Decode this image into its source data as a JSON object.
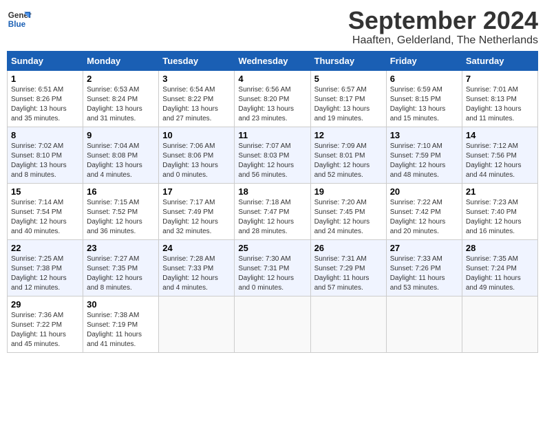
{
  "logo": {
    "line1": "General",
    "line2": "Blue"
  },
  "title": "September 2024",
  "location": "Haaften, Gelderland, The Netherlands",
  "days_of_week": [
    "Sunday",
    "Monday",
    "Tuesday",
    "Wednesday",
    "Thursday",
    "Friday",
    "Saturday"
  ],
  "weeks": [
    [
      {
        "day": "1",
        "sunrise": "Sunrise: 6:51 AM",
        "sunset": "Sunset: 8:26 PM",
        "daylight": "Daylight: 13 hours and 35 minutes."
      },
      {
        "day": "2",
        "sunrise": "Sunrise: 6:53 AM",
        "sunset": "Sunset: 8:24 PM",
        "daylight": "Daylight: 13 hours and 31 minutes."
      },
      {
        "day": "3",
        "sunrise": "Sunrise: 6:54 AM",
        "sunset": "Sunset: 8:22 PM",
        "daylight": "Daylight: 13 hours and 27 minutes."
      },
      {
        "day": "4",
        "sunrise": "Sunrise: 6:56 AM",
        "sunset": "Sunset: 8:20 PM",
        "daylight": "Daylight: 13 hours and 23 minutes."
      },
      {
        "day": "5",
        "sunrise": "Sunrise: 6:57 AM",
        "sunset": "Sunset: 8:17 PM",
        "daylight": "Daylight: 13 hours and 19 minutes."
      },
      {
        "day": "6",
        "sunrise": "Sunrise: 6:59 AM",
        "sunset": "Sunset: 8:15 PM",
        "daylight": "Daylight: 13 hours and 15 minutes."
      },
      {
        "day": "7",
        "sunrise": "Sunrise: 7:01 AM",
        "sunset": "Sunset: 8:13 PM",
        "daylight": "Daylight: 13 hours and 11 minutes."
      }
    ],
    [
      {
        "day": "8",
        "sunrise": "Sunrise: 7:02 AM",
        "sunset": "Sunset: 8:10 PM",
        "daylight": "Daylight: 13 hours and 8 minutes."
      },
      {
        "day": "9",
        "sunrise": "Sunrise: 7:04 AM",
        "sunset": "Sunset: 8:08 PM",
        "daylight": "Daylight: 13 hours and 4 minutes."
      },
      {
        "day": "10",
        "sunrise": "Sunrise: 7:06 AM",
        "sunset": "Sunset: 8:06 PM",
        "daylight": "Daylight: 13 hours and 0 minutes."
      },
      {
        "day": "11",
        "sunrise": "Sunrise: 7:07 AM",
        "sunset": "Sunset: 8:03 PM",
        "daylight": "Daylight: 12 hours and 56 minutes."
      },
      {
        "day": "12",
        "sunrise": "Sunrise: 7:09 AM",
        "sunset": "Sunset: 8:01 PM",
        "daylight": "Daylight: 12 hours and 52 minutes."
      },
      {
        "day": "13",
        "sunrise": "Sunrise: 7:10 AM",
        "sunset": "Sunset: 7:59 PM",
        "daylight": "Daylight: 12 hours and 48 minutes."
      },
      {
        "day": "14",
        "sunrise": "Sunrise: 7:12 AM",
        "sunset": "Sunset: 7:56 PM",
        "daylight": "Daylight: 12 hours and 44 minutes."
      }
    ],
    [
      {
        "day": "15",
        "sunrise": "Sunrise: 7:14 AM",
        "sunset": "Sunset: 7:54 PM",
        "daylight": "Daylight: 12 hours and 40 minutes."
      },
      {
        "day": "16",
        "sunrise": "Sunrise: 7:15 AM",
        "sunset": "Sunset: 7:52 PM",
        "daylight": "Daylight: 12 hours and 36 minutes."
      },
      {
        "day": "17",
        "sunrise": "Sunrise: 7:17 AM",
        "sunset": "Sunset: 7:49 PM",
        "daylight": "Daylight: 12 hours and 32 minutes."
      },
      {
        "day": "18",
        "sunrise": "Sunrise: 7:18 AM",
        "sunset": "Sunset: 7:47 PM",
        "daylight": "Daylight: 12 hours and 28 minutes."
      },
      {
        "day": "19",
        "sunrise": "Sunrise: 7:20 AM",
        "sunset": "Sunset: 7:45 PM",
        "daylight": "Daylight: 12 hours and 24 minutes."
      },
      {
        "day": "20",
        "sunrise": "Sunrise: 7:22 AM",
        "sunset": "Sunset: 7:42 PM",
        "daylight": "Daylight: 12 hours and 20 minutes."
      },
      {
        "day": "21",
        "sunrise": "Sunrise: 7:23 AM",
        "sunset": "Sunset: 7:40 PM",
        "daylight": "Daylight: 12 hours and 16 minutes."
      }
    ],
    [
      {
        "day": "22",
        "sunrise": "Sunrise: 7:25 AM",
        "sunset": "Sunset: 7:38 PM",
        "daylight": "Daylight: 12 hours and 12 minutes."
      },
      {
        "day": "23",
        "sunrise": "Sunrise: 7:27 AM",
        "sunset": "Sunset: 7:35 PM",
        "daylight": "Daylight: 12 hours and 8 minutes."
      },
      {
        "day": "24",
        "sunrise": "Sunrise: 7:28 AM",
        "sunset": "Sunset: 7:33 PM",
        "daylight": "Daylight: 12 hours and 4 minutes."
      },
      {
        "day": "25",
        "sunrise": "Sunrise: 7:30 AM",
        "sunset": "Sunset: 7:31 PM",
        "daylight": "Daylight: 12 hours and 0 minutes."
      },
      {
        "day": "26",
        "sunrise": "Sunrise: 7:31 AM",
        "sunset": "Sunset: 7:29 PM",
        "daylight": "Daylight: 11 hours and 57 minutes."
      },
      {
        "day": "27",
        "sunrise": "Sunrise: 7:33 AM",
        "sunset": "Sunset: 7:26 PM",
        "daylight": "Daylight: 11 hours and 53 minutes."
      },
      {
        "day": "28",
        "sunrise": "Sunrise: 7:35 AM",
        "sunset": "Sunset: 7:24 PM",
        "daylight": "Daylight: 11 hours and 49 minutes."
      }
    ],
    [
      {
        "day": "29",
        "sunrise": "Sunrise: 7:36 AM",
        "sunset": "Sunset: 7:22 PM",
        "daylight": "Daylight: 11 hours and 45 minutes."
      },
      {
        "day": "30",
        "sunrise": "Sunrise: 7:38 AM",
        "sunset": "Sunset: 7:19 PM",
        "daylight": "Daylight: 11 hours and 41 minutes."
      },
      null,
      null,
      null,
      null,
      null
    ]
  ]
}
